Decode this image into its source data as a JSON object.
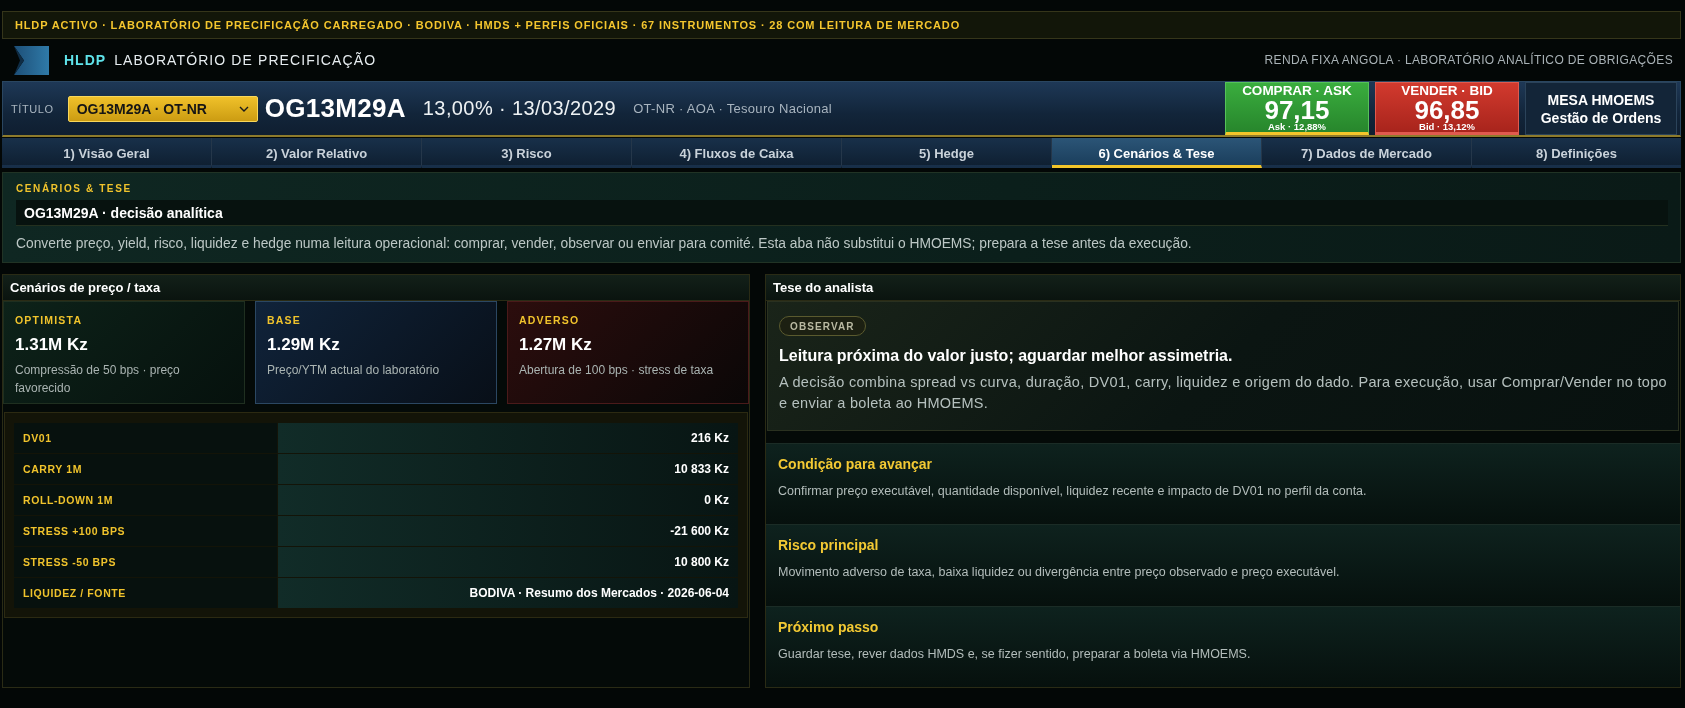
{
  "banner": {
    "text": "HLDP ACTIVO · LABORATÓRIO DE PRECIFICAÇÃO CARREGADO · BODIVA · HMDS + PERFIS OFICIAIS · 67 INSTRUMENTOS · 28 COM LEITURA DE MERCADO"
  },
  "header": {
    "brand": "HLDP",
    "title": "LABORATÓRIO DE PRECIFICAÇÃO",
    "subtitle": "RENDA FIXA ANGOLA · LABORATÓRIO ANALÍTICO DE OBRIGAÇÕES"
  },
  "instrument_bar": {
    "label": "TÍTULO",
    "select": {
      "value": "OG13M29A · OT-NR"
    },
    "code": "OG13M29A",
    "coupon_maturity": "13,00% · 13/03/2029",
    "details": "OT-NR · AOA · Tesouro Nacional",
    "quotes": [
      {
        "kind": "buy",
        "title": "COMPRAR · ASK",
        "price": "97,15",
        "sub": "Ask · 12,88%",
        "selected": true
      },
      {
        "kind": "sell",
        "title": "VENDER · BID",
        "price": "96,85",
        "sub": "Bid · 13,12%",
        "selected": false
      }
    ],
    "desk": {
      "line_1": "MESA HMOEMS",
      "line_2": "Gestão de Ordens"
    }
  },
  "tabs": [
    {
      "label": "1) Visão Geral",
      "selected": false
    },
    {
      "label": "2) Valor Relativo",
      "selected": false
    },
    {
      "label": "3) Risco",
      "selected": false
    },
    {
      "label": "4) Fluxos de Caixa",
      "selected": false
    },
    {
      "label": "5) Hedge",
      "selected": false
    },
    {
      "label": "6) Cenários & Tese",
      "selected": true
    },
    {
      "label": "7) Dados de Mercado",
      "selected": false
    },
    {
      "label": "8) Definições",
      "selected": false
    }
  ],
  "intro": {
    "eyebrow": "CENÁRIOS & TESE",
    "title": "OG13M29A · decisão analítica",
    "text": "Converte preço, yield, risco, liquidez e hedge numa leitura operacional: comprar, vender, observar ou enviar para comité. Esta aba não substitui o HMOEMS; prepara a tese antes da execução."
  },
  "scenarios": {
    "title": "Cenários de preço / taxa",
    "cards": [
      {
        "kind": "optimistic",
        "label": "OPTIMISTA",
        "value": "1.31M Kz",
        "note": "Compressão de 50 bps · preço favorecido"
      },
      {
        "kind": "base",
        "label": "BASE",
        "value": "1.29M Kz",
        "note": "Preço/YTM actual do laboratório"
      },
      {
        "kind": "adverse",
        "label": "ADVERSO",
        "value": "1.27M Kz",
        "note": "Abertura de 100 bps · stress de taxa"
      }
    ],
    "metrics": [
      {
        "label": "DV01",
        "value": "216 Kz"
      },
      {
        "label": "CARRY 1M",
        "value": "10 833 Kz"
      },
      {
        "label": "ROLL-DOWN 1M",
        "value": "0 Kz"
      },
      {
        "label": "STRESS +100 BPS",
        "value": "-21 600 Kz"
      },
      {
        "label": "STRESS -50 BPS",
        "value": "10 800 Kz"
      },
      {
        "label": "LIQUIDEZ / FONTE",
        "value": "BODIVA · Resumo dos Mercados · 2026-06-04"
      }
    ]
  },
  "thesis": {
    "title": "Tese do analista",
    "badge": "OBSERVAR",
    "headline": "Leitura próxima do valor justo; aguardar melhor assimetria.",
    "text": "A decisão combina spread vs curva, duração, DV01, carry, liquidez e origem do dado. Para execução, usar Comprar/Vender no topo e enviar a boleta ao HMOEMS.",
    "sections": [
      {
        "title": "Condição para avançar",
        "text": "Confirmar preço executável, quantidade disponível, liquidez recente e impacto de DV01 no perfil da conta."
      },
      {
        "title": "Risco principal",
        "text": "Movimento adverso de taxa, baixa liquidez ou divergência entre preço observado e preço executável."
      },
      {
        "title": "Próximo passo",
        "text": "Guardar tese, rever dados HMDS e, se fizer sentido, preparar a boleta via HMOEMS."
      }
    ]
  }
}
